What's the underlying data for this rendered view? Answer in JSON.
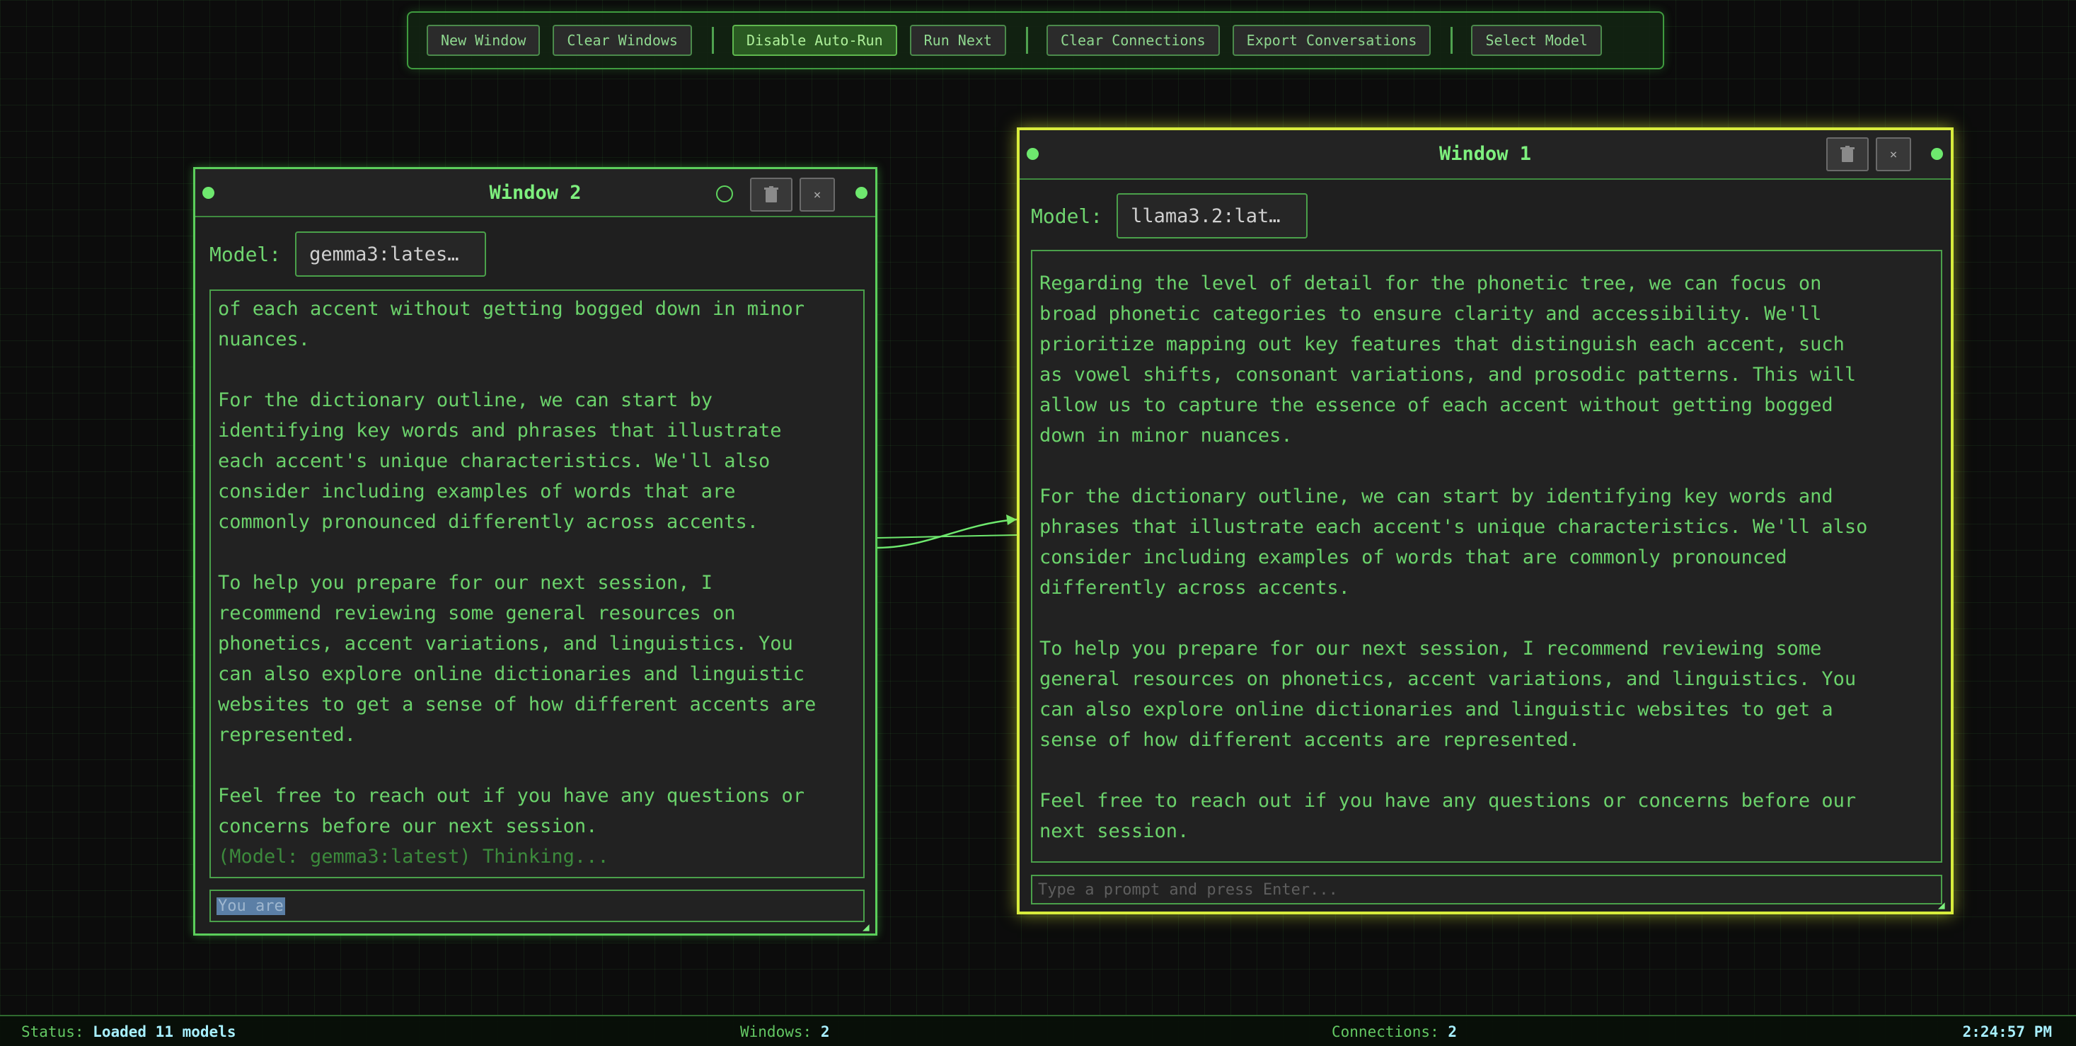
{
  "toolbar": {
    "new_window": "New Window",
    "clear_windows": "Clear Windows",
    "disable_auto_run": "Disable Auto-Run",
    "run_next": "Run Next",
    "clear_connections": "Clear Connections",
    "export_conversations": "Export Conversations",
    "select_model": "Select Model"
  },
  "window2": {
    "title": "Window 2",
    "model_label": "Model:",
    "model_value": "gemma3:lates…",
    "messages": [
      "of each accent without getting bogged down in minor\nnuances.",
      "For the dictionary outline, we can start by\nidentifying key words and phrases that illustrate\neach accent's unique characteristics. We'll also\nconsider including examples of words that are\ncommonly pronounced differently across accents.",
      "To help you prepare for our next session, I\nrecommend reviewing some general resources on\nphonetics, accent variations, and linguistics. You\ncan also explore online dictionaries and linguistic\nwebsites to get a sense of how different accents are\nrepresented.",
      "Feel free to reach out if you have any questions or\nconcerns before our next session."
    ],
    "thinking": "(Model: gemma3:latest) Thinking...",
    "prompt_value": "You are "
  },
  "window1": {
    "title": "Window 1",
    "model_label": "Model:",
    "model_value": "llama3.2:lat…",
    "messages": [
      "Regarding the level of detail for the phonetic tree, we can focus on\nbroad phonetic categories to ensure clarity and accessibility. We'll\nprioritize mapping out key features that distinguish each accent, such\nas vowel shifts, consonant variations, and prosodic patterns. This will\nallow us to capture the essence of each accent without getting bogged\ndown in minor nuances.",
      "For the dictionary outline, we can start by identifying key words and\nphrases that illustrate each accent's unique characteristics. We'll also\nconsider including examples of words that are commonly pronounced\ndifferently across accents.",
      "To help you prepare for our next session, I recommend reviewing some\ngeneral resources on phonetics, accent variations, and linguistics. You\ncan also explore online dictionaries and linguistic websites to get a\nsense of how different accents are represented.",
      "Feel free to reach out if you have any questions or concerns before our\nnext session."
    ],
    "prompt_placeholder": "Type a prompt and press Enter..."
  },
  "status": {
    "status_label": "Status:",
    "status_value": "Loaded 11 models",
    "windows_label": "Windows:",
    "windows_value": "2",
    "connections_label": "Connections:",
    "connections_value": "2",
    "clock": "2:24:57 PM"
  },
  "icons": {
    "trash": "trash-icon",
    "close": "×",
    "resize": "◢"
  },
  "colors": {
    "accent": "#5ed45e",
    "active_window_border": "#d8ec3c",
    "status_value": "#a8f0ff"
  }
}
